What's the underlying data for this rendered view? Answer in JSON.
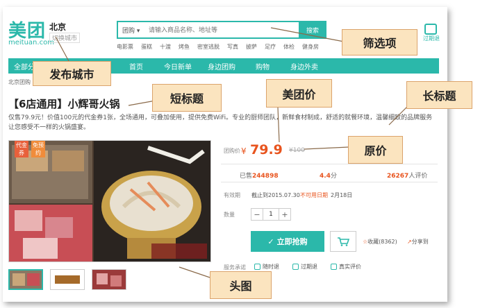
{
  "header": {
    "logo": "美团",
    "logo_sub": "meituan.com",
    "city": "北京",
    "city_switch": "切换城市",
    "search_category": "团购 ▾",
    "search_placeholder": "请输入商品名称、地址等",
    "search_button": "搜索",
    "hot_words": [
      "电影票",
      "蛋糕",
      "十渡",
      "烤鱼",
      "密室逃脱",
      "写真",
      "披萨",
      "足疗",
      "体检",
      "健身房"
    ],
    "refund_label": "过期退"
  },
  "nav": {
    "category_partial": "全部分",
    "items": [
      "首页",
      "今日新单",
      "身边团购",
      "购物",
      "身边外卖"
    ]
  },
  "breadcrumb": "北京团购 »",
  "deal": {
    "short_title": "【6店通用】小辉哥火锅",
    "description": "仅售79.9元！价值100元的代金券1张，全场通用，可叠加使用，提供免费WiFi。专业的厨师团队，新鲜食材制成，舒适的就餐环境，温馨细致的品牌服务让您感受不一样的火锅盛宴。",
    "badge_top": "代金券",
    "badge_bottom": "免预约"
  },
  "price": {
    "label": "团购价",
    "currency": "¥",
    "current": "79.9",
    "original": "¥100"
  },
  "stats": {
    "sold_prefix": "已售",
    "sold": "244898",
    "rating": "4.4",
    "rating_unit": "分",
    "reviews": "26267",
    "reviews_suffix": "人评价"
  },
  "validity": {
    "label": "有效期",
    "value": "截止到2015.07.30",
    "unavailable": "不可用日期",
    "unavailable_date": "2月18日"
  },
  "quantity": {
    "label": "数量",
    "value": "1",
    "minus": "−",
    "plus": "+"
  },
  "actions": {
    "buy": "立即抢购",
    "favorite": "收藏(8362)",
    "share": "分享到"
  },
  "service": {
    "label": "服务承诺",
    "items": [
      "随时退",
      "过期退",
      "真实评价"
    ]
  },
  "annotations": {
    "city": "发布城市",
    "filter": "筛选项",
    "short_title": "短标题",
    "price": "美团价",
    "long_title": "长标题",
    "original_price": "原价",
    "head_image": "头图"
  },
  "colors": {
    "brand": "#2bb8aa",
    "price": "#e8541e",
    "callout_bg": "#fbe4bf",
    "callout_border": "#dba36b"
  }
}
